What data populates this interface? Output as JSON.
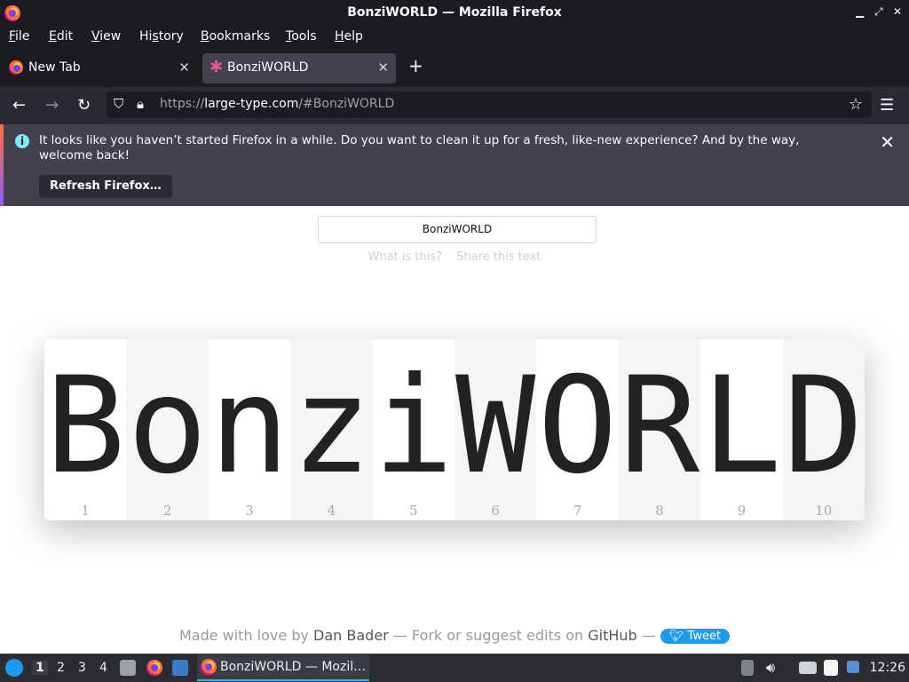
{
  "window": {
    "title": "BonziWORLD — Mozilla Firefox"
  },
  "menu": [
    {
      "label": "File",
      "u": "F",
      "rest": "ile"
    },
    {
      "label": "Edit",
      "u": "E",
      "rest": "dit"
    },
    {
      "label": "View",
      "u": "V",
      "rest": "iew"
    },
    {
      "label": "History",
      "pre": "Hi",
      "u": "s",
      "rest": "tory"
    },
    {
      "label": "Bookmarks",
      "u": "B",
      "rest": "ookmarks"
    },
    {
      "label": "Tools",
      "u": "T",
      "rest": "ools"
    },
    {
      "label": "Help",
      "u": "H",
      "rest": "elp"
    }
  ],
  "tabs": [
    {
      "label": "New Tab"
    },
    {
      "label": "BonziWORLD"
    }
  ],
  "urlbar": {
    "scheme": "https://",
    "host": "large-type.com",
    "path": "/#BonziWORLD"
  },
  "notification": {
    "message": "It looks like you haven’t started Firefox in a while. Do you want to clean it up for a fresh, like-new experience? And by the way, welcome back!",
    "button": "Refresh Firefox…"
  },
  "page": {
    "input_value": "BonziWORLD",
    "link_what": "What is this?",
    "link_share": "Share this text",
    "letters": [
      "B",
      "o",
      "n",
      "z",
      "i",
      "W",
      "O",
      "R",
      "L",
      "D"
    ],
    "numbers": [
      "1",
      "2",
      "3",
      "4",
      "5",
      "6",
      "7",
      "8",
      "9",
      "10"
    ],
    "footer": {
      "made": "Made with love by",
      "author": "Dan Bader",
      "fork": "— Fork or suggest edits on",
      "github": "GitHub",
      "dash": "—",
      "tweet": "Tweet"
    }
  },
  "taskbar": {
    "workspaces": [
      "1",
      "2",
      "3",
      "4"
    ],
    "window_label": "BonziWORLD — Mozil…",
    "clock": "12:26"
  },
  "colors": {
    "accent": "#3daee9",
    "tweet": "#1d9bf0",
    "notice_bg": "#42414d"
  }
}
